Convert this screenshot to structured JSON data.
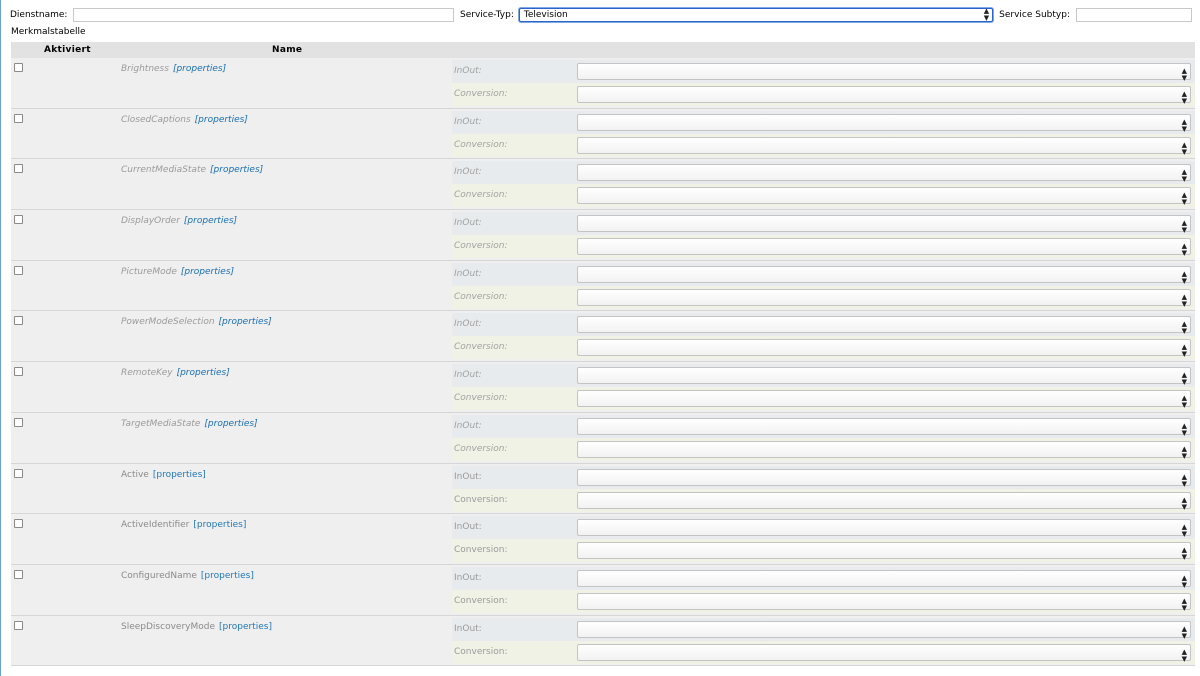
{
  "top": {
    "dienstname_label": "Dienstname:",
    "dienstname_value": "",
    "service_typ_label": "Service-Typ:",
    "service_typ_value": "Television",
    "service_subtyp_label": "Service Subtyp:",
    "service_subtyp_value": ""
  },
  "table": {
    "caption": "Merkmalstabelle",
    "header_aktiviert": "Aktiviert",
    "header_name": "Name",
    "properties_link": "[properties]",
    "inout_label": "InOut:",
    "conversion_label": "Conversion:",
    "rows": [
      {
        "name": "Brightness",
        "optional": true,
        "checked": false,
        "inout": "",
        "conversion": ""
      },
      {
        "name": "ClosedCaptions",
        "optional": true,
        "checked": false,
        "inout": "",
        "conversion": ""
      },
      {
        "name": "CurrentMediaState",
        "optional": true,
        "checked": false,
        "inout": "",
        "conversion": ""
      },
      {
        "name": "DisplayOrder",
        "optional": true,
        "checked": false,
        "inout": "",
        "conversion": ""
      },
      {
        "name": "PictureMode",
        "optional": true,
        "checked": false,
        "inout": "",
        "conversion": ""
      },
      {
        "name": "PowerModeSelection",
        "optional": true,
        "checked": false,
        "inout": "",
        "conversion": ""
      },
      {
        "name": "RemoteKey",
        "optional": true,
        "checked": false,
        "inout": "",
        "conversion": ""
      },
      {
        "name": "TargetMediaState",
        "optional": true,
        "checked": false,
        "inout": "",
        "conversion": ""
      },
      {
        "name": "Active",
        "optional": false,
        "checked": false,
        "inout": "",
        "conversion": ""
      },
      {
        "name": "ActiveIdentifier",
        "optional": false,
        "checked": false,
        "inout": "",
        "conversion": ""
      },
      {
        "name": "ConfiguredName",
        "optional": false,
        "checked": false,
        "inout": "",
        "conversion": ""
      },
      {
        "name": "SleepDiscoveryMode",
        "optional": false,
        "checked": false,
        "inout": "",
        "conversion": ""
      }
    ]
  },
  "colors": {
    "link": "#1a6fb5",
    "header_bg": "#e2e2e2",
    "row_bg": "#efefef",
    "inout_bg": "#e8ebee",
    "conversion_bg": "#f1f2e6",
    "focus_border": "#2b64c8"
  },
  "icons": {
    "select_arrows": "up-down-arrows-icon"
  }
}
